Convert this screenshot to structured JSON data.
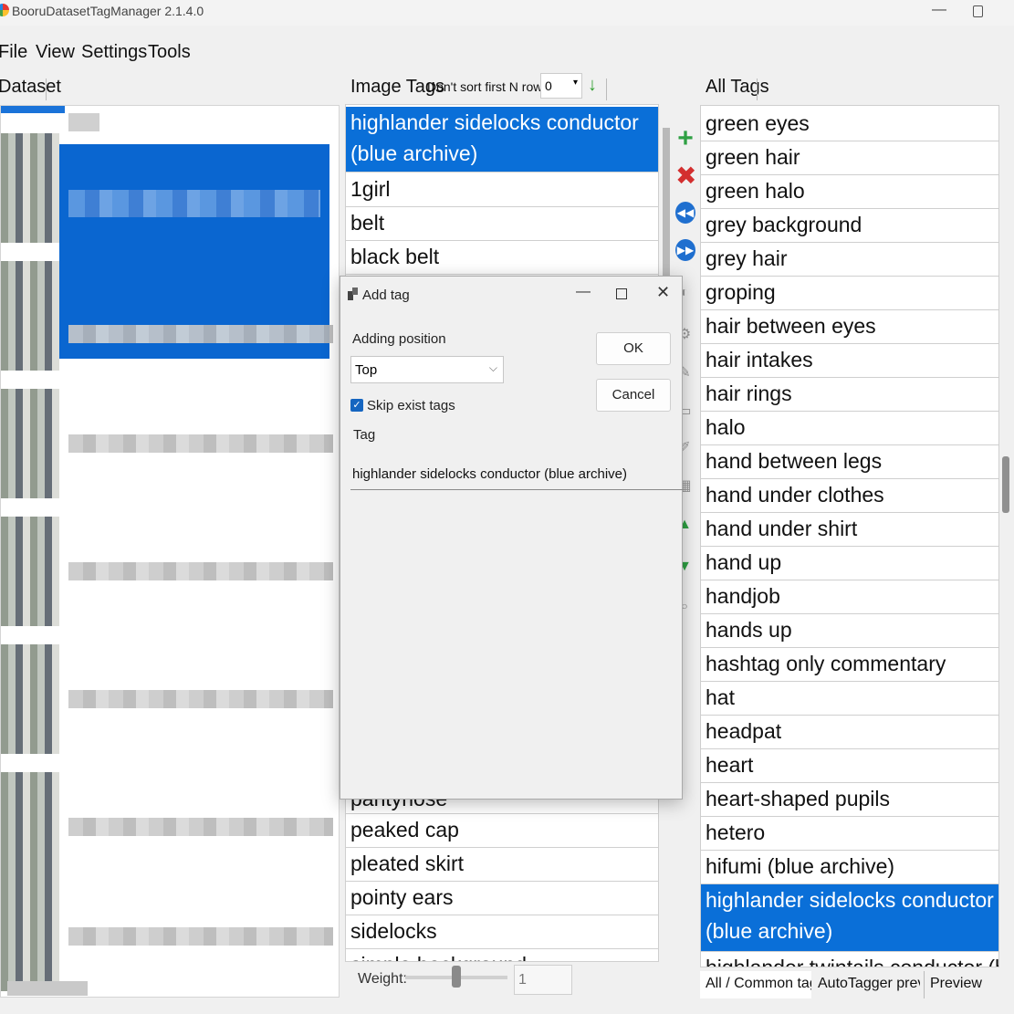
{
  "app": {
    "title": "BooruDatasetTagManager 2.1.4.0",
    "minimize": "—"
  },
  "menu": [
    "File",
    "View",
    "Settings",
    "Tools"
  ],
  "dataset": {
    "label": "Dataset"
  },
  "image_tags": {
    "label": "Image Tags",
    "sort_label": "Don't sort first N rows :",
    "sort_value": "0",
    "top_tags": [
      "highlander sidelocks conductor (blue archive)",
      "1girl",
      "belt",
      "black belt"
    ],
    "bottom_tags": [
      "pantyhose",
      "peaked cap",
      "pleated skirt",
      "pointy ears",
      "sidelocks",
      "simple background"
    ]
  },
  "weight": {
    "label": "Weight:",
    "value": "1"
  },
  "all_tags": {
    "label": "All Tags",
    "items": [
      "green eyes",
      "green hair",
      "green halo",
      "grey background",
      "grey hair",
      "groping",
      "hair between eyes",
      "hair intakes",
      "hair rings",
      "halo",
      "hand between legs",
      "hand under clothes",
      "hand under shirt",
      "hand up",
      "handjob",
      "hands up",
      "hashtag only commentary",
      "hat",
      "headpat",
      "heart",
      "heart-shaped pupils",
      "hetero",
      "hifumi (blue archive)",
      "highlander sidelocks conductor (blue archive)",
      "highlander twintails conductor (blue archive)"
    ],
    "selected_index": 23
  },
  "tabs": [
    "All / Common tags",
    "AutoTagger previe...",
    "Preview"
  ],
  "dialog": {
    "title": "Add tag",
    "adding_position_label": "Adding position",
    "adding_position_value": "Top",
    "ok": "OK",
    "cancel": "Cancel",
    "skip_exist_label": "Skip exist tags",
    "skip_exist_checked": true,
    "tag_label": "Tag",
    "tag_value": "highlander sidelocks conductor (blue archive)"
  },
  "icons": {
    "add": "plus-icon",
    "remove": "x-icon",
    "prev": "rewind-icon",
    "next": "fast-forward-icon",
    "apply_sort": "green-down-arrow-icon"
  },
  "colors": {
    "selection": "#0a6fd8",
    "add": "#2ea043",
    "remove": "#d32f2f"
  }
}
